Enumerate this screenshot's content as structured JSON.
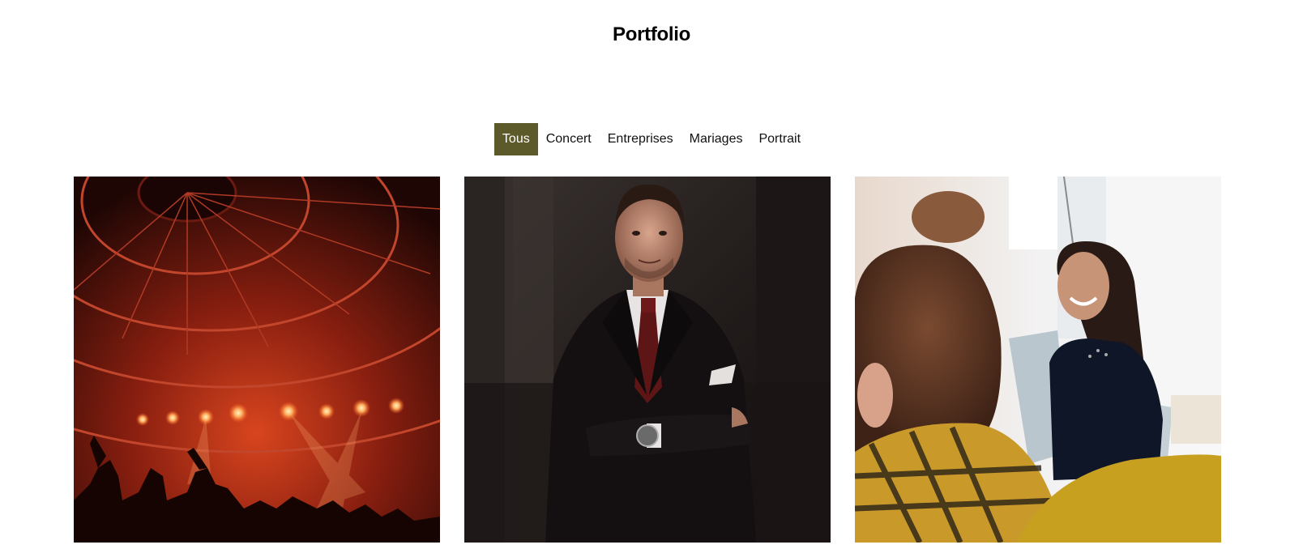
{
  "page": {
    "title": "Portfolio"
  },
  "filters": [
    {
      "label": "Tous",
      "active": true
    },
    {
      "label": "Concert",
      "active": false
    },
    {
      "label": "Entreprises",
      "active": false
    },
    {
      "label": "Mariages",
      "active": false
    },
    {
      "label": "Portrait",
      "active": false
    }
  ],
  "theme": {
    "accent": "#5c5a2a"
  },
  "gallery": [
    {
      "subject": "concert-stage-photo"
    },
    {
      "subject": "businessman-portrait-photo"
    },
    {
      "subject": "office-meeting-photo"
    }
  ]
}
